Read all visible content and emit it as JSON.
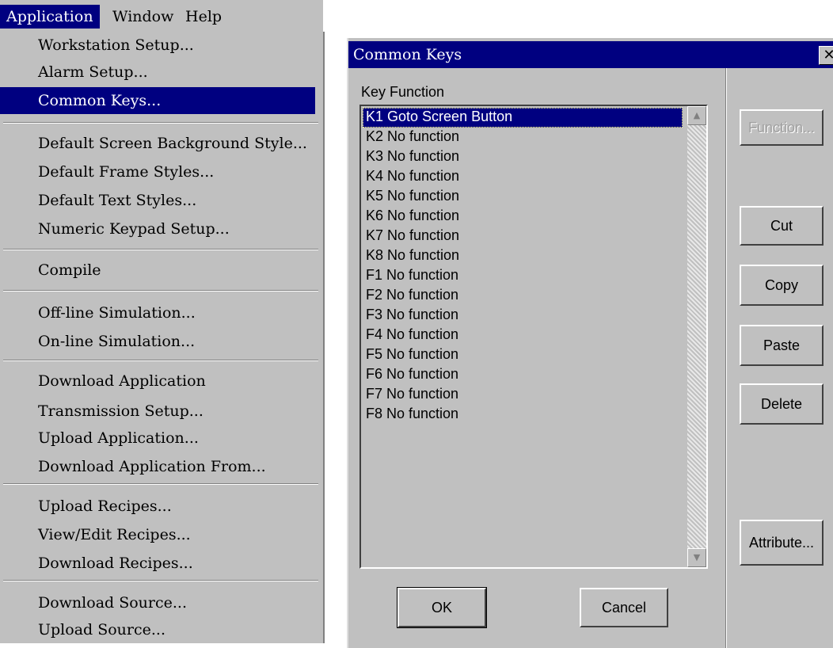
{
  "menubar": {
    "items": [
      {
        "label": "Application"
      },
      {
        "label": "Window"
      },
      {
        "label": "Help"
      }
    ]
  },
  "menu": {
    "items": [
      "Workstation Setup...",
      "Alarm Setup...",
      "Common Keys...",
      "Default Screen Background Style...",
      "Default Frame Styles...",
      "Default Text Styles...",
      "Numeric Keypad Setup...",
      "Compile",
      "Off-line Simulation...",
      "On-line Simulation...",
      "Download Application",
      "Transmission Setup...",
      "Upload Application...",
      "Download Application From...",
      "Upload Recipes...",
      "View/Edit Recipes...",
      "Download Recipes...",
      "Download Source...",
      "Upload Source..."
    ],
    "selected": "Common Keys..."
  },
  "dialog": {
    "title": "Common Keys",
    "close_glyph": "✕",
    "list_label": "Key Function",
    "list_items": [
      "K1 Goto Screen Button",
      "K2 No function",
      "K3 No function",
      "K4 No function",
      "K5 No function",
      "K6 No function",
      "K7 No function",
      "K8 No function",
      "F1 No function",
      "F2 No function",
      "F3 No function",
      "F4 No function",
      "F5 No function",
      "F6 No function",
      "F7 No function",
      "F8 No function"
    ],
    "selected_item": "K1 Goto Screen Button",
    "buttons": {
      "function": "Function...",
      "cut": "Cut",
      "copy": "Copy",
      "paste": "Paste",
      "delete": "Delete",
      "attribute": "Attribute...",
      "ok": "OK",
      "cancel": "Cancel"
    },
    "scroll_up_glyph": "▲",
    "scroll_down_glyph": "▼"
  },
  "colors": {
    "highlight": "#000080",
    "face": "#c0c0c0"
  }
}
